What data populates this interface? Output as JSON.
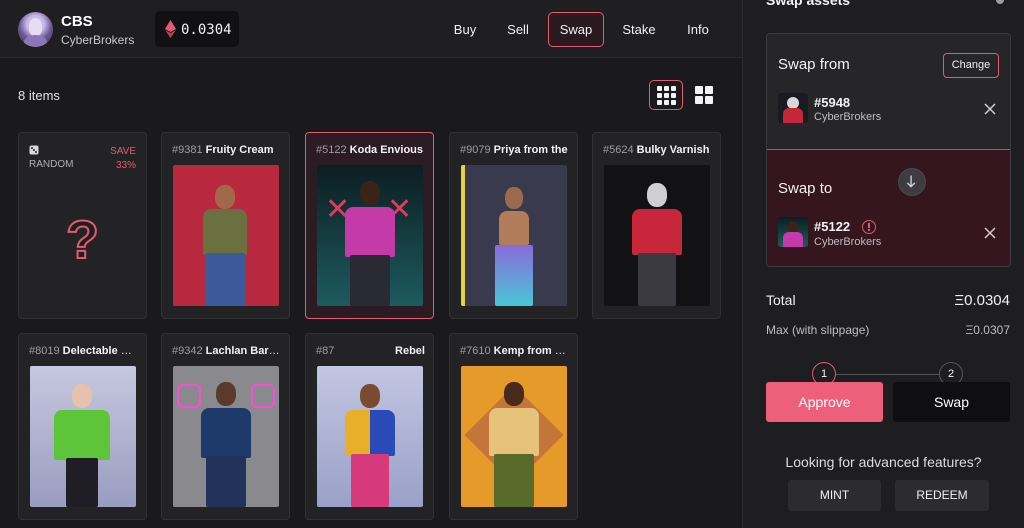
{
  "header": {
    "brand_title": "CBS",
    "brand_subtitle": "CyberBrokers",
    "eth_balance": "0.0304",
    "nav": [
      {
        "label": "Buy"
      },
      {
        "label": "Sell"
      },
      {
        "label": "Swap"
      },
      {
        "label": "Stake"
      },
      {
        "label": "Info"
      }
    ],
    "active_tab": "Swap"
  },
  "main": {
    "item_count": "8 items",
    "random_card": {
      "label": "RANDOM",
      "save_label": "SAVE",
      "save_pct": "33%",
      "mark": "?"
    },
    "cards": [
      {
        "number": "#9381",
        "name": "Fruity Cream"
      },
      {
        "number": "#5122",
        "name": "Koda Envious"
      },
      {
        "number": "#9079",
        "name": "Priya from the"
      },
      {
        "number": "#5624",
        "name": "Bulky Varnish"
      },
      {
        "number": "#8019",
        "name": "Delectable Bot"
      },
      {
        "number": "#9342",
        "name": "Lachlan Barrow"
      },
      {
        "number": "#87",
        "name": "Rebel"
      },
      {
        "number": "#7610",
        "name": "Kemp from the"
      }
    ]
  },
  "panel": {
    "title": "Swap assets",
    "swap_from": {
      "title": "Swap from",
      "change_label": "Change",
      "token_id": "#5948",
      "collection": "CyberBrokers"
    },
    "swap_to": {
      "title": "Swap to",
      "token_id": "#5122",
      "collection": "CyberBrokers"
    },
    "total_label": "Total",
    "total_value": "Ξ0.0304",
    "max_label": "Max (with slippage)",
    "max_value": "Ξ0.0307",
    "step1": "1",
    "step2": "2",
    "approve_label": "Approve",
    "swap_label": "Swap",
    "advanced_text": "Looking for advanced features?",
    "mint_label": "MINT",
    "redeem_label": "REDEEM"
  },
  "colors": {
    "accent": "#e25a73",
    "approve": "#ee5f7a",
    "background": "#1b1b1d"
  }
}
